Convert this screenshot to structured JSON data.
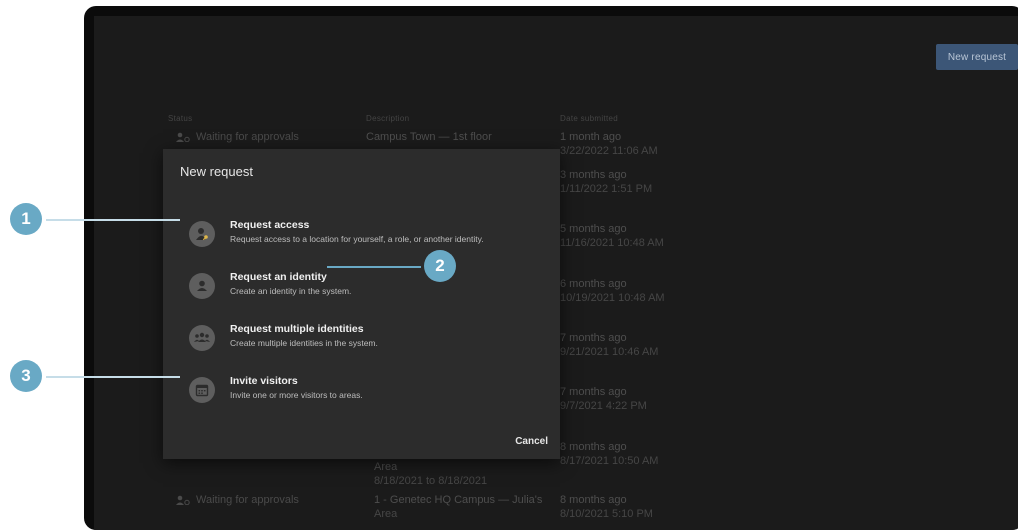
{
  "toolbar": {
    "new_request_label": "New request"
  },
  "table": {
    "headers": {
      "status": "Status",
      "description": "Description",
      "date": "Date submitted"
    },
    "rows": [
      {
        "status": "Waiting for approvals",
        "description": "Campus Town — 1st floor",
        "description2": "",
        "date_rel": "1 month ago",
        "date_abs": "3/22/2022  11:06 AM"
      },
      {
        "status": "",
        "description": "",
        "description2": "",
        "date_rel": "3 months ago",
        "date_abs": "1/11/2022  1:51 PM"
      },
      {
        "status": "",
        "description": "",
        "description2": "",
        "date_rel": "5 months ago",
        "date_abs": "11/16/2021  10:48 AM"
      },
      {
        "status": "",
        "description": "",
        "description2": "",
        "date_rel": "6 months ago",
        "date_abs": "10/19/2021  10:48 AM"
      },
      {
        "status": "",
        "description": "",
        "description2": "",
        "date_rel": "7 months ago",
        "date_abs": "9/21/2021  10:46 AM"
      },
      {
        "status": "",
        "description": "",
        "description2": "",
        "date_rel": "7 months ago",
        "date_abs": "9/7/2021  4:22 PM"
      },
      {
        "status": "",
        "description": "Area",
        "description2": "8/18/2021  to  8/18/2021",
        "date_rel": "8 months ago",
        "date_abs": "8/17/2021  10:50 AM"
      },
      {
        "status": "Waiting for approvals",
        "description": "1 - Genetec HQ Campus — Julia's",
        "description2": "Area",
        "date_rel": "8 months ago",
        "date_abs": "8/10/2021  5:10 PM"
      }
    ]
  },
  "dialog": {
    "title": "New request",
    "options": [
      {
        "title": "Request access",
        "desc": "Request access to a location for yourself, a role, or another identity.",
        "icon": "person-key-icon"
      },
      {
        "title": "Request an identity",
        "desc": "Create an identity in the system.",
        "icon": "person-icon"
      },
      {
        "title": "Request multiple identities",
        "desc": "Create multiple identities in the system.",
        "icon": "group-icon"
      },
      {
        "title": "Invite visitors",
        "desc": "Invite one or more visitors to areas.",
        "icon": "calendar-icon"
      }
    ],
    "cancel_label": "Cancel"
  },
  "callouts": {
    "c1": "1",
    "c2": "2",
    "c3": "3"
  },
  "colors": {
    "accent": "#69a9c5",
    "dialog_bg": "#2c2c2c",
    "screen_bg": "#1b1b1b",
    "button_bg": "#3c5677"
  }
}
